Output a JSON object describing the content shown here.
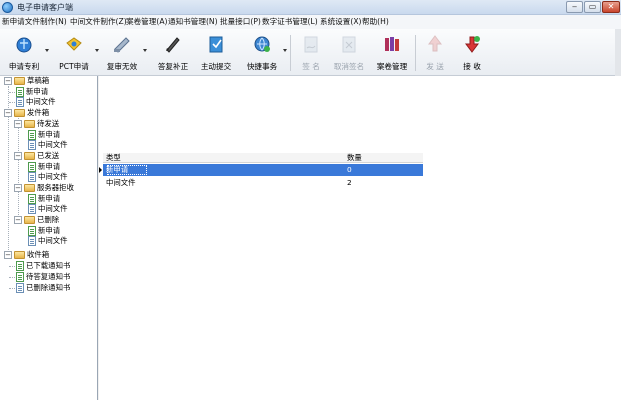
{
  "window": {
    "title": "电子申请客户端",
    "minimize": "‒",
    "maximize": "▭",
    "close": "✕"
  },
  "menu": [
    "新申请文件制作(N)",
    "中间文件制作(Z)",
    "案卷管理(A)",
    "通知书管理(N)",
    "批量接口(P)",
    "数字证书管理(L)",
    "系统设置(X)",
    "帮助(H)"
  ],
  "toolbar": {
    "items": [
      {
        "label": "申请专利",
        "icon": "patent-apply-icon",
        "enabled": true
      },
      {
        "label": "PCT申请",
        "icon": "pct-apply-icon",
        "enabled": true
      },
      {
        "label": "复审无效",
        "icon": "review-invalid-icon",
        "enabled": true
      },
      {
        "label": "答复补正",
        "icon": "reply-correct-icon",
        "enabled": true
      },
      {
        "label": "主动提交",
        "icon": "active-submit-icon",
        "enabled": true
      },
      {
        "label": "快捷事务",
        "icon": "quick-task-icon",
        "enabled": true
      },
      {
        "label": "签 名",
        "icon": "sign-icon",
        "enabled": false
      },
      {
        "label": "取消签名",
        "icon": "cancel-sign-icon",
        "enabled": false
      },
      {
        "label": "案卷管理",
        "icon": "case-manage-icon",
        "enabled": true
      },
      {
        "label": "发 送",
        "icon": "send-icon",
        "enabled": false
      },
      {
        "label": "接 收",
        "icon": "receive-icon",
        "enabled": true
      }
    ]
  },
  "tree": {
    "drafts": {
      "label": "草稿箱",
      "children": [
        "新申请",
        "中间文件"
      ]
    },
    "outbox": {
      "label": "发件箱",
      "pending": {
        "label": "待发送",
        "children": [
          "新申请",
          "中间文件"
        ]
      },
      "sent": {
        "label": "已发送",
        "children": [
          "新申请",
          "中间文件"
        ]
      },
      "rejected": {
        "label": "服务器拒收",
        "children": [
          "新申请",
          "中间文件"
        ]
      },
      "deleted": {
        "label": "已删除",
        "children": [
          "新申请",
          "中间文件"
        ]
      }
    },
    "inbox": {
      "label": "收件箱",
      "children": [
        "已下载通知书",
        "待答复通知书",
        "已删除通知书"
      ]
    }
  },
  "grid": {
    "columns": [
      "类型",
      "数量"
    ],
    "rows": [
      {
        "type": "新申请",
        "count": "0",
        "selected": true
      },
      {
        "type": "中间文件",
        "count": "2",
        "selected": false
      }
    ]
  }
}
